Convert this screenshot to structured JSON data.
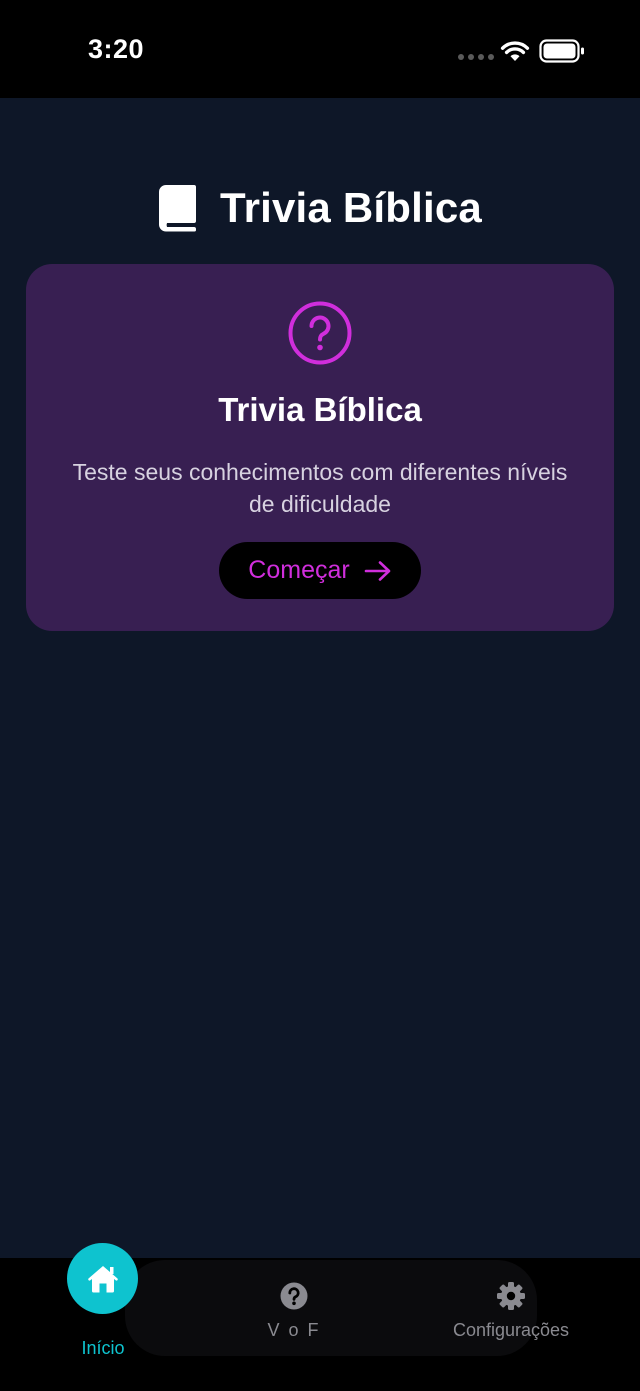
{
  "status_bar": {
    "time": "3:20"
  },
  "header": {
    "icon": "book-icon",
    "title": "Trivia Bíblica"
  },
  "card": {
    "icon": "question-circle-icon",
    "title": "Trivia Bíblica",
    "description": "Teste seus conhecimentos com diferentes níveis de dificuldade",
    "button_label": "Começar",
    "button_icon": "arrow-right-icon"
  },
  "tabs": [
    {
      "label": "Início",
      "icon": "home-icon",
      "active": true
    },
    {
      "label": "V o F",
      "icon": "question-icon",
      "active": false
    },
    {
      "label": "Configurações",
      "icon": "gear-icon",
      "active": false
    }
  ],
  "colors": {
    "background": "#0e1728",
    "card": "#381f52",
    "accent_magenta": "#d02edc",
    "accent_cyan": "#0ec3cf",
    "inactive_tab": "#8a8a90"
  }
}
